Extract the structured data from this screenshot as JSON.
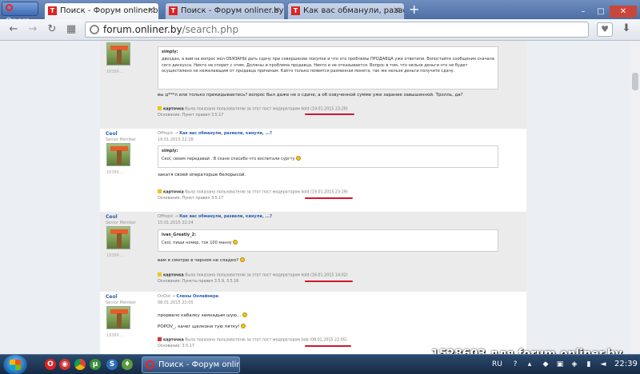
{
  "browser": {
    "menu_label": "Opera",
    "tabs": [
      {
        "title": "Поиск - Форум onliner.by",
        "active": true
      },
      {
        "title": "Поиск - Форум onliner.by",
        "active": false
      },
      {
        "title": "Как вас обманули, развели...",
        "active": false
      }
    ],
    "new_tab": "+",
    "address": {
      "host": "forum.onliner.by",
      "path": "/search.php"
    }
  },
  "posts": [
    {
      "uid": "18386 ...",
      "quote_author": "simply:",
      "quote_text": "двоздан, а вам на вопрос мол ОБЯЗАНЫ дать сдачу при совершении покупки и что это проблемы ПРОДАВЦА уже ответили. Вопостайте сообщения сначала сего дискусса. Никто не спорит с этим. Должны и проблема продавца. Никто и не отказывается. Вопрос в том, что нельзя деньги что не будет осуществлено не нежелающим от продавца причинам. Каkто только появятся разменная монета, так же нельзя деньги получите сдачу.",
      "text": "вы д***л или только прикидываетесь? вопрос был даже не о сдаче, а об озвученной сумме уже заранее завышенной. Тролль, да?",
      "mod_prefix": "карточка",
      "mod_line": "была показана пользователю за этот пост модератором kold",
      "mod_date": "(19.01.2015 23:20)",
      "reason_label": "Основание:",
      "reason": "Пункт правил 3.5.17"
    },
    {
      "author": "Ceol",
      "rank": "Senior Member",
      "uid": "18386 ...",
      "topic_prefix": "Offtopic →",
      "topic": "Как вас обманули, развели, кинули, ...?",
      "time": "19.01.2015 22:28",
      "quote_author": "simply:",
      "quote_text": "Ceol, своим передавай . В скане спасибо что воспитали сургту",
      "text": "закатя своей операторше белорысой.",
      "mod_prefix": "карточка",
      "mod_line": "была показана пользователю за этот пост модератором kold",
      "mod_date": "(19.01.2015 23:19)",
      "reason_label": "Основание:",
      "reason": "Пункт правил 3.5.17"
    },
    {
      "author": "Ceol",
      "rank": "Senior Member",
      "uid": "18386 ...",
      "topic_prefix": "Offtopic →",
      "topic": "Как вас обманули, развели, кинули, ...?",
      "time": "15.01.2015 22:24",
      "quote_author": "ivan_Greatly_2:",
      "quote_text": "Ceol, пиши номер, ток 100 манну",
      "text": "вам я смотрю в черном не сладко?",
      "mod_prefix": "карточка",
      "mod_line": "была показана пользователю за этот пост модератором kold",
      "mod_date": "(16.01.2015 14:02)",
      "reason_label": "Основание:",
      "reason": "Пункты правил 3.5.9, 3.5.16"
    },
    {
      "author": "Ceol",
      "rank": "Senior Member",
      "uid": "18386 ...",
      "topic_prefix": "OnOut →",
      "topic": "Слены Онлайнера",
      "time": "08.01.2015 22:05",
      "text_line1": "прорвало кабалку замнадым шую...",
      "text_line2": "POPOV_, качег щелкони тую пятку!",
      "mod_prefix": "карточка",
      "mod_line": "была показана пользователю за этот пост модератором bob",
      "mod_date": "(08.01.2015 22:05)",
      "reason_label": "Основание:",
      "reason": "3.5.17"
    }
  ],
  "watermark": "1528603 для forum.onliner.by",
  "taskbar": {
    "task_title": "Поиск - Форум onliner...",
    "lang": "RU",
    "clock": "22:39"
  },
  "colors": {
    "underline": "#d0162e",
    "link": "#2a5db0",
    "card_yellow": "#f0c419",
    "card_red": "#d33333"
  }
}
